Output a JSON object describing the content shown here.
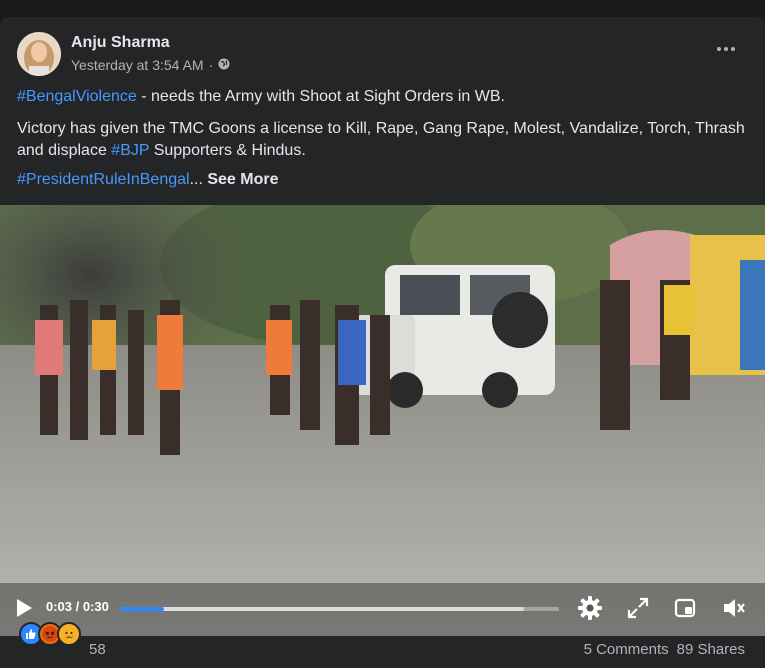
{
  "post": {
    "author": "Anju Sharma",
    "timestamp": "Yesterday at 3:54 AM",
    "privacy_icon": "globe-icon",
    "hashtag1": "#BengalViolence",
    "line1_rest": " - needs the Army with Shoot at Sight Orders in WB.",
    "line2_a": "Victory has given the TMC Goons a license to Kill, Rape, Gang Rape, Molest, Vandalize, Torch, Thrash and displace ",
    "hashtag2": "#BJP",
    "line2_b": " Supporters & Hindus.",
    "hashtag3": "#PresidentRuleInBengal",
    "ellipsis": "...",
    "see_more": "See More"
  },
  "video": {
    "current_time": "0:03",
    "separator": " / ",
    "duration": "0:30",
    "progress": 0.1,
    "buffered": 0.92
  },
  "reactions": {
    "icons": [
      "like-icon",
      "angry-icon",
      "sad-icon"
    ],
    "count": "58"
  },
  "stats": {
    "comments": "5 Comments",
    "shares": "89 Shares"
  },
  "colors": {
    "background": "#18191a",
    "card": "#242526",
    "link": "#4599ff",
    "progress": "#2d88ff"
  }
}
